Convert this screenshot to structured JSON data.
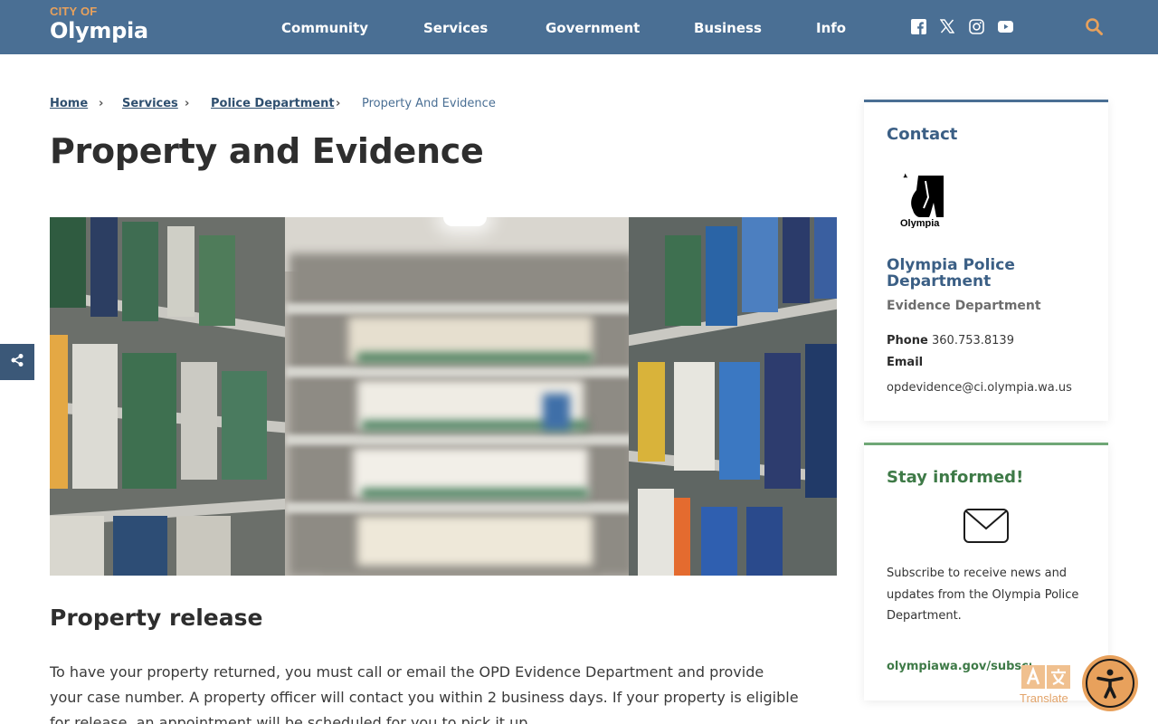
{
  "header": {
    "logo_small": "CITY OF",
    "logo_big": "Olympia",
    "nav": [
      "Community",
      "Services",
      "Government",
      "Business",
      "Info"
    ],
    "social_icons": [
      "facebook-icon",
      "x-icon",
      "instagram-icon",
      "youtube-icon"
    ],
    "search_icon": "search-icon",
    "colors": {
      "bar": "#4a6f94",
      "accent": "#e8a15c"
    }
  },
  "breadcrumb": {
    "items": [
      "Home",
      "Services",
      "Police Department"
    ],
    "separator": "›",
    "current": "Property And Evidence"
  },
  "page": {
    "title": "Property and Evidence",
    "hero_alt": "library-shelves-image",
    "section_title": "Property release",
    "paragraph": "To have your property returned, you must call or email the OPD Evidence Department and provide your case number. A property officer will contact you within 2 business days. If your property is eligible for release, an appointment will be scheduled for you to pick it up."
  },
  "contact": {
    "title": "Contact",
    "logo_icon": "olympia-police-logo-icon",
    "logo_text": "Olympia",
    "org_name": "Olympia Police Department",
    "department": "Evidence Department",
    "phone_label": "Phone",
    "phone": "360.753.8139",
    "email_label": "Email",
    "email": "opdevidence@ci.olympia.wa.us",
    "accent": "#4a6f94"
  },
  "inform": {
    "title": "Stay informed!",
    "icon": "envelope-icon",
    "text": "Subscribe to receive news and updates from the Olympia Police Department.",
    "link": "olympiawa.gov/subscribe",
    "accent": "#6fa776"
  },
  "widgets": {
    "share_icon": "share-icon",
    "translate_label": "Translate",
    "translate_icon": "translate-icon",
    "accessibility_icon": "accessibility-icon"
  }
}
